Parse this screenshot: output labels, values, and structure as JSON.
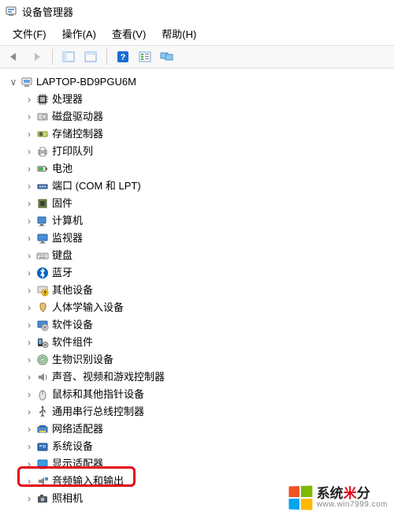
{
  "title": "设备管理器",
  "menu": {
    "file": "文件(F)",
    "action": "操作(A)",
    "view": "查看(V)",
    "help": "帮助(H)"
  },
  "toolbar": {
    "back": "back",
    "forward": "forward",
    "show_hidden": "show-hidden",
    "help": "help",
    "details": "details",
    "monitor": "monitor"
  },
  "root": {
    "label": "LAPTOP-BD9PGU6M",
    "expanded": true
  },
  "nodes": [
    {
      "label": "处理器",
      "icon": "cpu"
    },
    {
      "label": "磁盘驱动器",
      "icon": "disk"
    },
    {
      "label": "存储控制器",
      "icon": "storage"
    },
    {
      "label": "打印队列",
      "icon": "printer"
    },
    {
      "label": "电池",
      "icon": "battery"
    },
    {
      "label": "端口 (COM 和 LPT)",
      "icon": "port"
    },
    {
      "label": "固件",
      "icon": "firmware"
    },
    {
      "label": "计算机",
      "icon": "computer"
    },
    {
      "label": "监视器",
      "icon": "monitor"
    },
    {
      "label": "键盘",
      "icon": "keyboard"
    },
    {
      "label": "蓝牙",
      "icon": "bluetooth"
    },
    {
      "label": "其他设备",
      "icon": "other"
    },
    {
      "label": "人体学输入设备",
      "icon": "hid"
    },
    {
      "label": "软件设备",
      "icon": "software"
    },
    {
      "label": "软件组件",
      "icon": "software-comp"
    },
    {
      "label": "生物识别设备",
      "icon": "biometric"
    },
    {
      "label": "声音、视频和游戏控制器",
      "icon": "sound"
    },
    {
      "label": "鼠标和其他指针设备",
      "icon": "mouse"
    },
    {
      "label": "通用串行总线控制器",
      "icon": "usb"
    },
    {
      "label": "网络适配器",
      "icon": "network"
    },
    {
      "label": "系统设备",
      "icon": "system"
    },
    {
      "label": "显示适配器",
      "icon": "display",
      "highlighted": true
    },
    {
      "label": "音频输入和输出",
      "icon": "audio-io"
    },
    {
      "label": "照相机",
      "icon": "camera"
    }
  ],
  "watermark": {
    "text_prefix": "系统",
    "text_star": "米",
    "text_suffix": "分",
    "sub": "www.win7999.com"
  }
}
